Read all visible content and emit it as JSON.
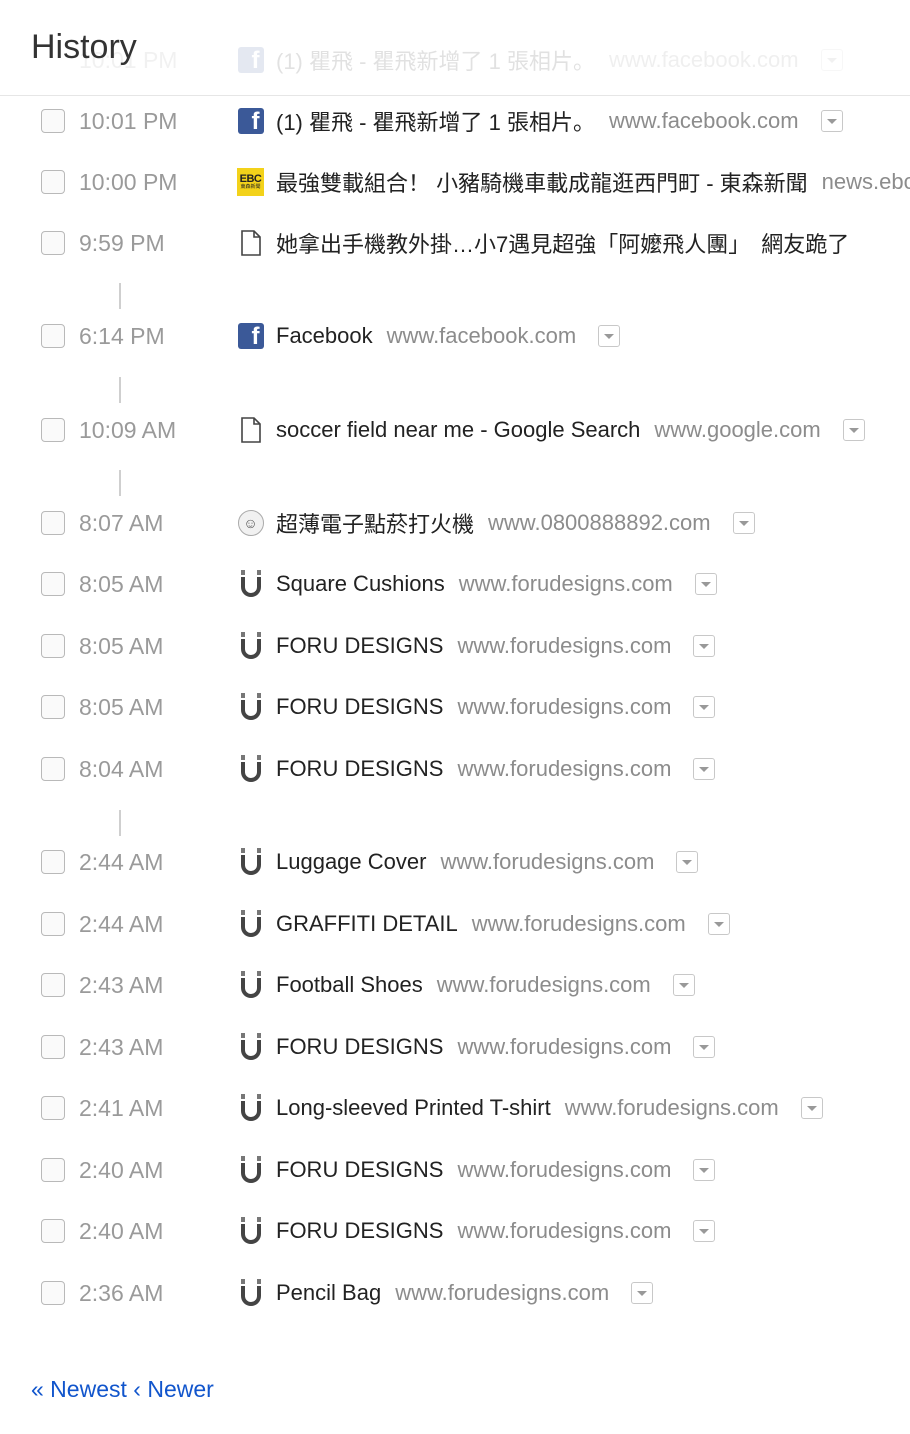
{
  "header": {
    "title": "History"
  },
  "ghost_row": {
    "time": "10:01 PM",
    "title": "(1) 瞿飛 - 瞿飛新增了 1 張相片。",
    "domain": "www.facebook.com",
    "icon": "facebook-icon"
  },
  "rows": [
    {
      "time": "10:01 PM",
      "title": "(1) 瞿飛 - 瞿飛新增了 1 張相片。",
      "domain": "www.facebook.com",
      "icon": "facebook-icon"
    },
    {
      "time": "10:00 PM",
      "title": "最強雙載組合！ 小豬騎機車載成龍逛西門町 - 東森新聞",
      "domain": "news.ebc.net.tw",
      "icon": "ebc-icon"
    },
    {
      "time": "9:59 PM",
      "title": "她拿出手機教外掛…小7遇見超強「阿嬤飛人團」　網友跪了",
      "domain": "",
      "icon": "page-icon"
    },
    {
      "time": "6:14 PM",
      "title": "Facebook",
      "domain": "www.facebook.com",
      "icon": "facebook-icon"
    },
    {
      "time": "10:09 AM",
      "title": "soccer field near me - Google Search",
      "domain": "www.google.com",
      "icon": "page-icon"
    },
    {
      "time": "8:07 AM",
      "title": "超薄電子點菸打火機",
      "domain": "www.0800888892.com",
      "icon": "mask-icon"
    },
    {
      "time": "8:05 AM",
      "title": "Square Cushions",
      "domain": "www.forudesigns.com",
      "icon": "foru-icon"
    },
    {
      "time": "8:05 AM",
      "title": "FORU DESIGNS",
      "domain": "www.forudesigns.com",
      "icon": "foru-icon"
    },
    {
      "time": "8:05 AM",
      "title": "FORU DESIGNS",
      "domain": "www.forudesigns.com",
      "icon": "foru-icon"
    },
    {
      "time": "8:04 AM",
      "title": "FORU DESIGNS",
      "domain": "www.forudesigns.com",
      "icon": "foru-icon"
    },
    {
      "time": "2:44 AM",
      "title": "Luggage Cover",
      "domain": "www.forudesigns.com",
      "icon": "foru-icon"
    },
    {
      "time": "2:44 AM",
      "title": "GRAFFITI DETAIL",
      "domain": "www.forudesigns.com",
      "icon": "foru-icon"
    },
    {
      "time": "2:43 AM",
      "title": "Football Shoes",
      "domain": "www.forudesigns.com",
      "icon": "foru-icon"
    },
    {
      "time": "2:43 AM",
      "title": "FORU DESIGNS",
      "domain": "www.forudesigns.com",
      "icon": "foru-icon"
    },
    {
      "time": "2:41 AM",
      "title": "Long-sleeved Printed T-shirt",
      "domain": "www.forudesigns.com",
      "icon": "foru-icon"
    },
    {
      "time": "2:40 AM",
      "title": "FORU DESIGNS",
      "domain": "www.forudesigns.com",
      "icon": "foru-icon"
    },
    {
      "time": "2:40 AM",
      "title": "FORU DESIGNS",
      "domain": "www.forudesigns.com",
      "icon": "foru-icon"
    },
    {
      "time": "2:36 AM",
      "title": "Pencil Bag",
      "domain": "www.forudesigns.com",
      "icon": "foru-icon"
    }
  ],
  "pager": {
    "newest": "« Newest",
    "separator": "‹",
    "newer": "Newer"
  },
  "colors": {
    "link": "#1155cc",
    "facebook": "#3b5998",
    "ebc": "#f3d21a"
  }
}
